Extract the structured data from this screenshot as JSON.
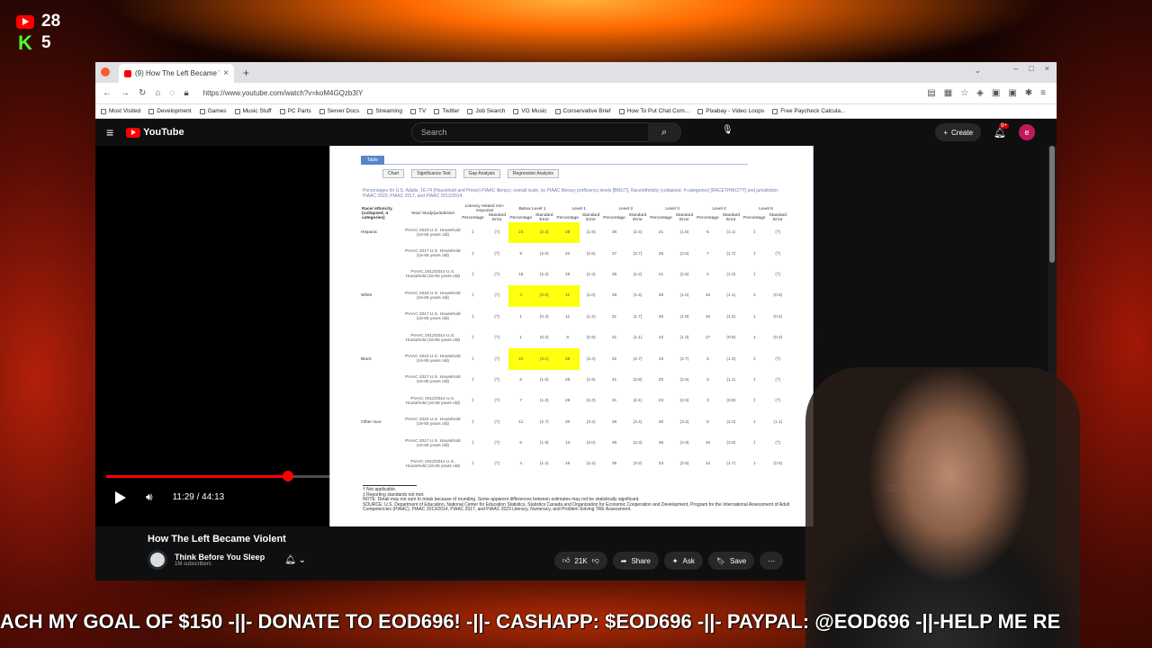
{
  "overlay": {
    "youtube_count": "28",
    "kick_count": "5",
    "ticker": "ACH MY GOAL OF $150 -||- DONATE TO EOD696! -||- CASHAPP: $EOD696 -||- PAYPAL: @EOD696 -||-HELP ME RE"
  },
  "browser": {
    "tab_title": "(9) How The Left Became Violen",
    "url": "https://www.youtube.com/watch?v=koM4GQzb3IY",
    "bookmarks": [
      "Most Visited",
      "Development",
      "Games",
      "Music Stuff",
      "PC Parts",
      "Server Docs",
      "Streaming",
      "TV",
      "Twitter",
      "Job Search",
      "VG Music",
      "Conservative Brief",
      "How To Put Chat Com...",
      "Pixabay - Video Loops",
      "Free Paycheck Calcula..."
    ]
  },
  "youtube": {
    "search_placeholder": "Search",
    "create_label": "Create",
    "notif_badge": "9+",
    "avatar_letter": "e",
    "logo_text": "YouTube"
  },
  "player": {
    "progress": 0.257,
    "current_time": "11:29",
    "duration": "44:13",
    "time_display": "11:29 / 44:13"
  },
  "video_info": {
    "title": "How The Left Became Violent",
    "channel": "Think Before You Sleep",
    "subscribers": "1M subscribers",
    "likes": "21K",
    "share_label": "Share",
    "ask_label": "Ask",
    "save_label": "Save"
  },
  "document": {
    "tab_label": "Table",
    "buttons": [
      "Chart",
      "Significance Test",
      "Gap Analysis",
      "Regression Analysis"
    ],
    "caption": "Percentages for U.S. Adults, 16-74 (Household and Prison) PIAAC literacy: overall scale, by PIAAC literacy proficiency levels [BMLIT], Race/ethnicity (collapsed, 4 categories) [RACETHNICITY] and jurisdiction: PIAAC 2023, PIAAC 2017, and PIAAC 2012/2014",
    "headers": [
      "Race/ ethnicity (collapsed, 4 categories)",
      "Year/ Study/jurisdiction",
      "Literacy related non-response",
      "Below Level 1",
      "Level 1",
      "Level 2",
      "Level 3",
      "Level 4",
      "Level 5"
    ],
    "subheaders": [
      "Percentage",
      "Standard Error",
      "Percentage",
      "Standard Error",
      "Percentage",
      "Standard Error",
      "Percentage",
      "Standard Error",
      "Percentage",
      "Standard Error",
      "Percentage",
      "Standard Error",
      "Percentage",
      "Standard Error"
    ],
    "rows": [
      {
        "group": "Hispanic",
        "year": "PIAAC 2023 U.S. Household (16-65 years old)",
        "cells": [
          "‡",
          "(†)",
          "24",
          "(2.4)",
          "28",
          "(1.9)",
          "28",
          "(2.4)",
          "21",
          "(1.8)",
          "6",
          "(1.1)",
          "‡",
          "(†)"
        ],
        "hl": [
          2,
          3,
          4
        ]
      },
      {
        "group": "",
        "year": "PIAAC 2017 U.S. Household (16-65 years old)",
        "cells": [
          "‡",
          "(†)",
          "9",
          "(2.0)",
          "22",
          "(2.5)",
          "37",
          "(3.7)",
          "25",
          "(3.5)",
          "7",
          "(1.7)",
          "‡",
          "(†)"
        ],
        "hl": []
      },
      {
        "group": "",
        "year": "PIAAC 2012/2014 U.S. Household (16-65 years old)",
        "cells": [
          "‡",
          "(†)",
          "15",
          "(2.2)",
          "25",
          "(2.3)",
          "35",
          "(2.2)",
          "21",
          "(2.5)",
          "4",
          "(1.0)",
          "‡",
          "(†)"
        ],
        "hl": []
      },
      {
        "group": "White",
        "year": "PIAAC 2023 U.S. Household (16-65 years old)",
        "cells": [
          "‡",
          "(†)",
          "4",
          "(0.6)",
          "11",
          "(1.0)",
          "28",
          "(1.4)",
          "38",
          "(1.5)",
          "16",
          "(1.1)",
          "2",
          "(0.5)"
        ],
        "hl": [
          2,
          3,
          4
        ]
      },
      {
        "group": "",
        "year": "PIAAC 2017 U.S. Household (16-65 years old)",
        "cells": [
          "‡",
          "(†)",
          "1",
          "(0.4)",
          "11",
          "(1.2)",
          "31",
          "(1.7)",
          "40",
          "(1.9)",
          "16",
          "(1.5)",
          "1",
          "(0.4)"
        ],
        "hl": []
      },
      {
        "group": "",
        "year": "PIAAC 2012/2014 U.S. Household (16-65 years old)",
        "cells": [
          "‡",
          "(†)",
          "1",
          "(0.2)",
          "8",
          "(0.9)",
          "31",
          "(1.1)",
          "42",
          "(1.3)",
          "17",
          "(0.9)",
          "1",
          "(0.2)"
        ],
        "hl": []
      },
      {
        "group": "Black",
        "year": "PIAAC 2023 U.S. Household (16-65 years old)",
        "cells": [
          "‡",
          "(†)",
          "22",
          "(3.1)",
          "28",
          "(2.4)",
          "32",
          "(2.7)",
          "15",
          "(2.7)",
          "3",
          "(1.3)",
          "‡",
          "(†)"
        ],
        "hl": [
          2,
          3,
          4
        ]
      },
      {
        "group": "",
        "year": "PIAAC 2017 U.S. Household (16-65 years old)",
        "cells": [
          "‡",
          "(†)",
          "6",
          "(1.5)",
          "28",
          "(2.9)",
          "41",
          "(3.8)",
          "20",
          "(2.6)",
          "3",
          "(1.1)",
          "‡",
          "(†)"
        ],
        "hl": []
      },
      {
        "group": "",
        "year": "PIAAC 2012/2014 U.S. Household (16-65 years old)",
        "cells": [
          "‡",
          "(†)",
          "7",
          "(1.3)",
          "26",
          "(2.3)",
          "41",
          "(2.1)",
          "23",
          "(2.0)",
          "3",
          "(0.8)",
          "‡",
          "(†)"
        ],
        "hl": []
      },
      {
        "group": "Other race",
        "year": "PIAAC 2023 U.S. Household (16-65 years old)",
        "cells": [
          "‡",
          "(†)",
          "11",
          "(2.7)",
          "20",
          "(3.2)",
          "28",
          "(3.4)",
          "30",
          "(3.4)",
          "9",
          "(2.0)",
          "1",
          "(1.1)"
        ],
        "hl": []
      },
      {
        "group": "",
        "year": "PIAAC 2017 U.S. Household (16-65 years old)",
        "cells": [
          "‡",
          "(†)",
          "6",
          "(1.9)",
          "13",
          "(3.0)",
          "35",
          "(3.3)",
          "36",
          "(4.9)",
          "10",
          "(3.5)",
          "‡",
          "(†)"
        ],
        "hl": []
      },
      {
        "group": "",
        "year": "PIAAC 2012/2014 U.S. Household (16-65 years old)",
        "cells": [
          "‡",
          "(†)",
          "4",
          "(1.2)",
          "15",
          "(2.2)",
          "35",
          "(3.2)",
          "33",
          "(2.5)",
          "12",
          "(1.7)",
          "1",
          "(0.5)"
        ],
        "hl": []
      }
    ],
    "notes": [
      "† Not applicable.",
      "‡ Reporting standards not met.",
      "NOTE: Detail may not sum to totals because of rounding. Some apparent differences between estimates may not be statistically significant.",
      "SOURCE: U.S. Department of Education, National Center for Education Statistics, Statistics Canada and Organization for Economic Cooperation and Development, Program for the International Assessment of Adult Competencies (PIAAC), PIAAC 2013/2014, PIAAC 2017, and PIAAC 2023 Literacy, Numeracy, and Problem Solving TRE Assessment."
    ]
  }
}
